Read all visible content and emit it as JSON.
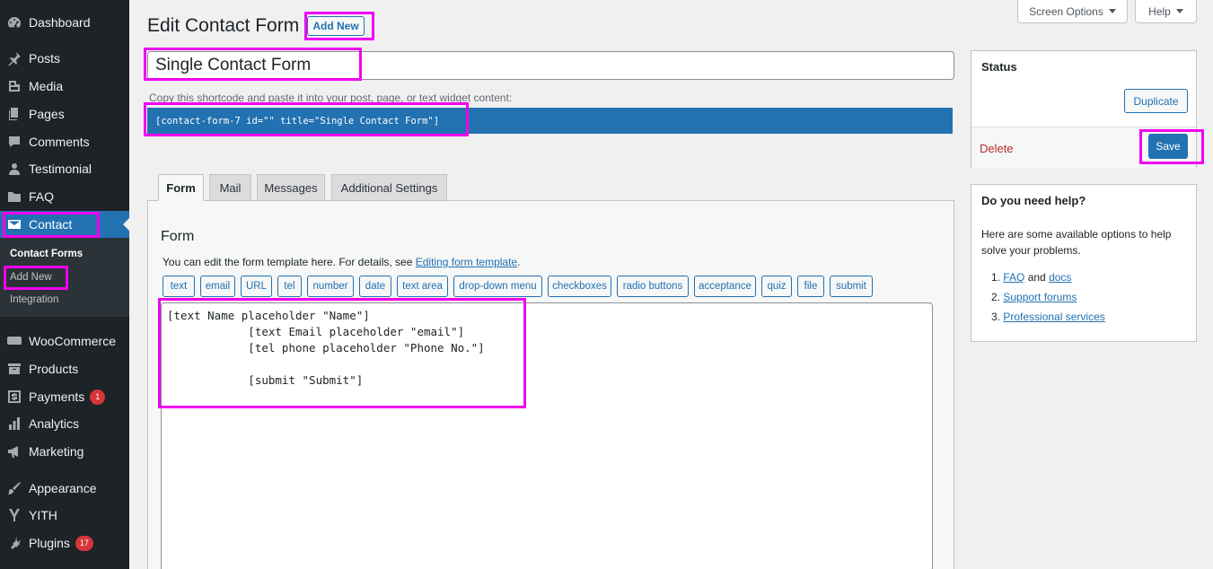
{
  "sidebar": {
    "items": [
      {
        "label": "Dashboard",
        "icon": "dashboard-icon",
        "badge": ""
      },
      {
        "label": "Posts",
        "icon": "pin-icon",
        "badge": ""
      },
      {
        "label": "Media",
        "icon": "media-icon",
        "badge": ""
      },
      {
        "label": "Pages",
        "icon": "pages-icon",
        "badge": ""
      },
      {
        "label": "Comments",
        "icon": "comment-icon",
        "badge": ""
      },
      {
        "label": "Testimonial",
        "icon": "user-icon",
        "badge": ""
      },
      {
        "label": "FAQ",
        "icon": "folder-icon",
        "badge": ""
      },
      {
        "label": "Contact",
        "icon": "mail-icon",
        "badge": ""
      },
      {
        "label": "WooCommerce",
        "icon": "woo-icon",
        "badge": ""
      },
      {
        "label": "Products",
        "icon": "archive-icon",
        "badge": ""
      },
      {
        "label": "Payments",
        "icon": "dollar-icon",
        "badge": "1"
      },
      {
        "label": "Analytics",
        "icon": "chart-bar-icon",
        "badge": ""
      },
      {
        "label": "Marketing",
        "icon": "megaphone-icon",
        "badge": ""
      },
      {
        "label": "Appearance",
        "icon": "brush-icon",
        "badge": ""
      },
      {
        "label": "YITH",
        "icon": "yith-icon",
        "badge": ""
      },
      {
        "label": "Plugins",
        "icon": "plugin-icon",
        "badge": "17"
      }
    ],
    "submenu": [
      "Contact Forms",
      "Add New",
      "Integration"
    ]
  },
  "header": {
    "title": "Edit Contact Form",
    "add_new": "Add New",
    "screen_options": "Screen Options",
    "help": "Help"
  },
  "form": {
    "title_value": "Single Contact Form",
    "shortcode_hint": "Copy this shortcode and paste it into your post, page, or text widget content:",
    "shortcode": "[contact-form-7 id=\"\" title=\"Single Contact Form\"]",
    "tabs": [
      "Form",
      "Mail",
      "Messages",
      "Additional Settings"
    ],
    "panel_heading": "Form",
    "panel_desc_prefix": "You can edit the form template here. For details, see ",
    "panel_desc_link": "Editing form template",
    "panel_desc_suffix": ".",
    "tag_buttons": [
      "text",
      "email",
      "URL",
      "tel",
      "number",
      "date",
      "text area",
      "drop-down menu",
      "checkboxes",
      "radio buttons",
      "acceptance",
      "quiz",
      "file",
      "submit"
    ],
    "template": "[text Name placeholder \"Name\"]\n            [text Email placeholder \"email\"]\n            [tel phone placeholder \"Phone No.\"]\n\n            [submit \"Submit\"]"
  },
  "status_box": {
    "heading": "Status",
    "duplicate": "Duplicate",
    "delete": "Delete",
    "save": "Save"
  },
  "help_box": {
    "heading": "Do you need help?",
    "intro": "Here are some available options to help solve your problems.",
    "items": [
      {
        "num": "1.",
        "link1": "FAQ",
        "and": " and ",
        "link2": "docs"
      },
      {
        "num": "2.",
        "link1": "Support forums"
      },
      {
        "num": "3.",
        "link1": "Professional services"
      }
    ]
  },
  "colors": {
    "highlight": "#f000f0",
    "wp_blue": "#2271b1",
    "sidebar_bg": "#1d2327",
    "badge_red": "#d63638",
    "delete_red": "#b32d2e"
  }
}
